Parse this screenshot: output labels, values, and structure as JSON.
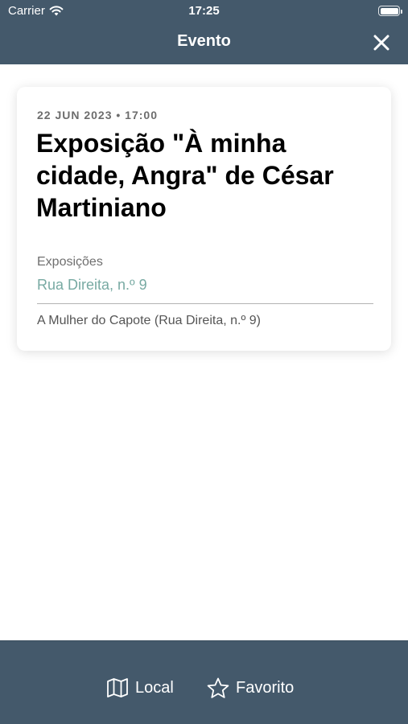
{
  "status_bar": {
    "carrier": "Carrier",
    "time": "17:25"
  },
  "nav": {
    "title": "Evento",
    "close_icon": "close-icon"
  },
  "event": {
    "datetime": "22 JUN 2023 • 17:00",
    "title": "Exposição \"À minha cidade, Angra\" de César Martiniano",
    "category": "Exposições",
    "address": "Rua Direita, n.º 9",
    "venue": "A Mulher do Capote (Rua Direita, n.º 9)"
  },
  "toolbar": {
    "local_label": "Local",
    "local_icon": "map-icon",
    "favorito_label": "Favorito",
    "favorito_icon": "star-icon"
  },
  "colors": {
    "bar_background": "#44596b",
    "link_accent": "#78aaa3"
  }
}
